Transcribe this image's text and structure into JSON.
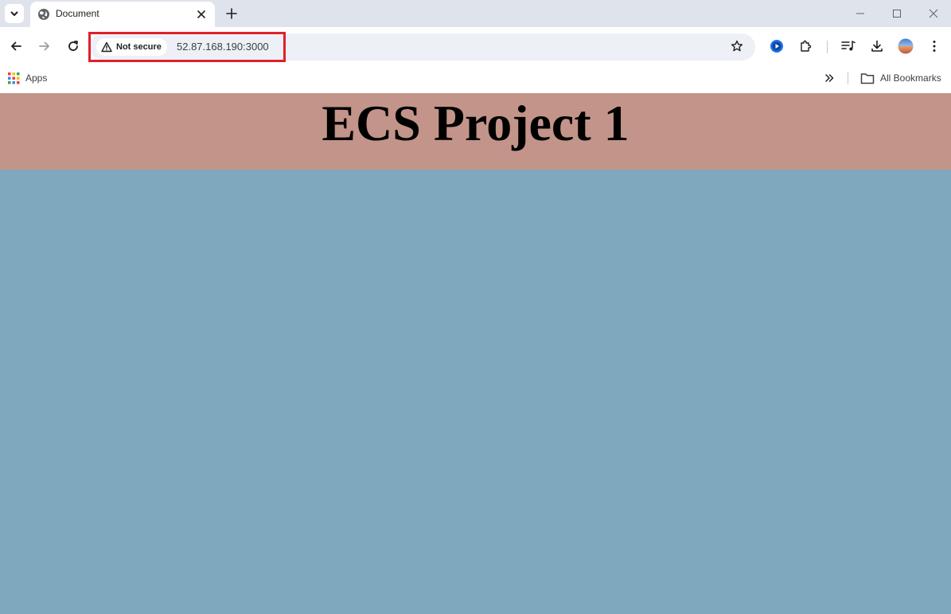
{
  "browser": {
    "tab": {
      "title": "Document",
      "icon": "globe-icon"
    },
    "address_bar": {
      "security_label": "Not secure",
      "url": "52.87.168.190:3000",
      "highlight_color": "#e0202a"
    },
    "bookmarks": {
      "apps_label": "Apps",
      "all_bookmarks_label": "All Bookmarks"
    }
  },
  "page": {
    "title": "ECS Project 1",
    "header_color": "#c39489",
    "body_color": "#7fa7bd"
  }
}
